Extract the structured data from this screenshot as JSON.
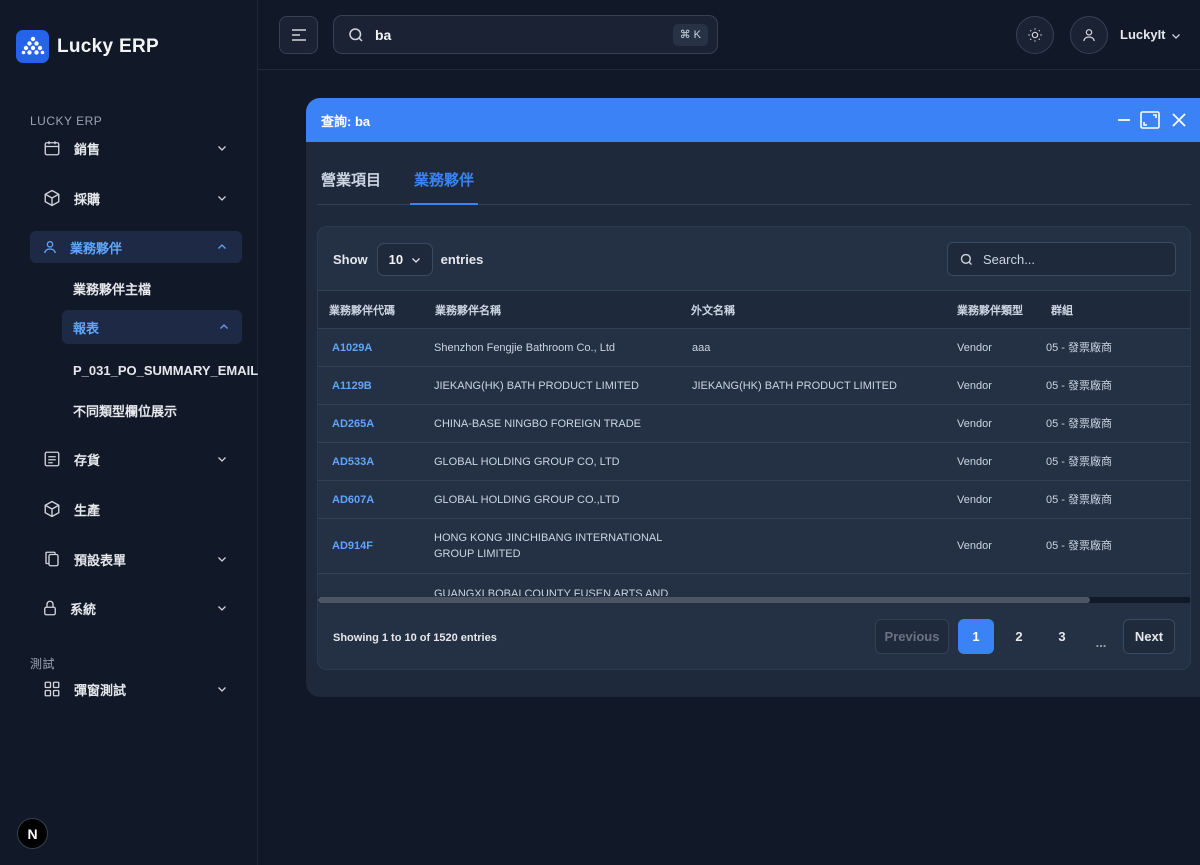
{
  "app": {
    "name": "Lucky ERP"
  },
  "sidebar": {
    "section_main": "LUCKY ERP",
    "section_test": "測試",
    "items": [
      {
        "label": "銷售",
        "icon": "calendar-icon"
      },
      {
        "label": "採購",
        "icon": "box-icon"
      },
      {
        "label": "業務夥伴",
        "icon": "user-icon"
      },
      {
        "label": "存貨",
        "icon": "list-icon"
      },
      {
        "label": "生產",
        "icon": "box-icon"
      },
      {
        "label": "預設表單",
        "icon": "copy-icon"
      },
      {
        "label": "系統",
        "icon": "lock-icon"
      },
      {
        "label": "彈窗測試",
        "icon": "grid-icon"
      }
    ],
    "subitems": {
      "partner_master": "業務夥伴主檔",
      "reports": "報表",
      "report_1": "P_031_PO_SUMMARY_EMAIL",
      "report_2": "不同類型欄位展示"
    },
    "badge": "N"
  },
  "topbar": {
    "search_value": "ba",
    "shortcut": "⌘ K",
    "user_name": "LuckyIt"
  },
  "modal": {
    "title": "查詢: ba",
    "tabs": [
      "營業項目",
      "業務夥伴"
    ],
    "active_tab": 1,
    "show_label": "Show",
    "entries_label": "entries",
    "page_size": "10",
    "search_placeholder": "Search...",
    "columns": [
      "業務夥伴代碼",
      "業務夥伴名稱",
      "外文名稱",
      "業務夥伴類型",
      "群組"
    ],
    "rows": [
      [
        "A1029A",
        "Shenzhon Fengjie Bathroom Co., Ltd",
        "aaa",
        "Vendor",
        "05 - 發票廠商"
      ],
      [
        "A1129B",
        "JIEKANG(HK) BATH PRODUCT LIMITED",
        "JIEKANG(HK) BATH PRODUCT LIMITED",
        "Vendor",
        "05 - 發票廠商"
      ],
      [
        "AD265A",
        "CHINA-BASE NINGBO FOREIGN TRADE",
        "",
        "Vendor",
        "05 - 發票廠商"
      ],
      [
        "AD533A",
        "GLOBAL HOLDING GROUP CO, LTD",
        "",
        "Vendor",
        "05 - 發票廠商"
      ],
      [
        "AD607A",
        "GLOBAL HOLDING GROUP CO.,LTD",
        "",
        "Vendor",
        "05 - 發票廠商"
      ],
      [
        "AD914F",
        "HONG KONG JINCHIBANG INTERNATIONAL GROUP LIMITED",
        "",
        "Vendor",
        "05 - 發票廠商"
      ],
      [
        "",
        "GUANGXI BOBAI COUNTY FUSEN ARTS AND",
        "",
        "",
        ""
      ]
    ],
    "info": "Showing 1 to 10 of 1520 entries",
    "pagination": {
      "previous": "Previous",
      "pages": [
        "1",
        "2",
        "3"
      ],
      "ellipsis": "...",
      "next": "Next",
      "current": "1"
    }
  }
}
